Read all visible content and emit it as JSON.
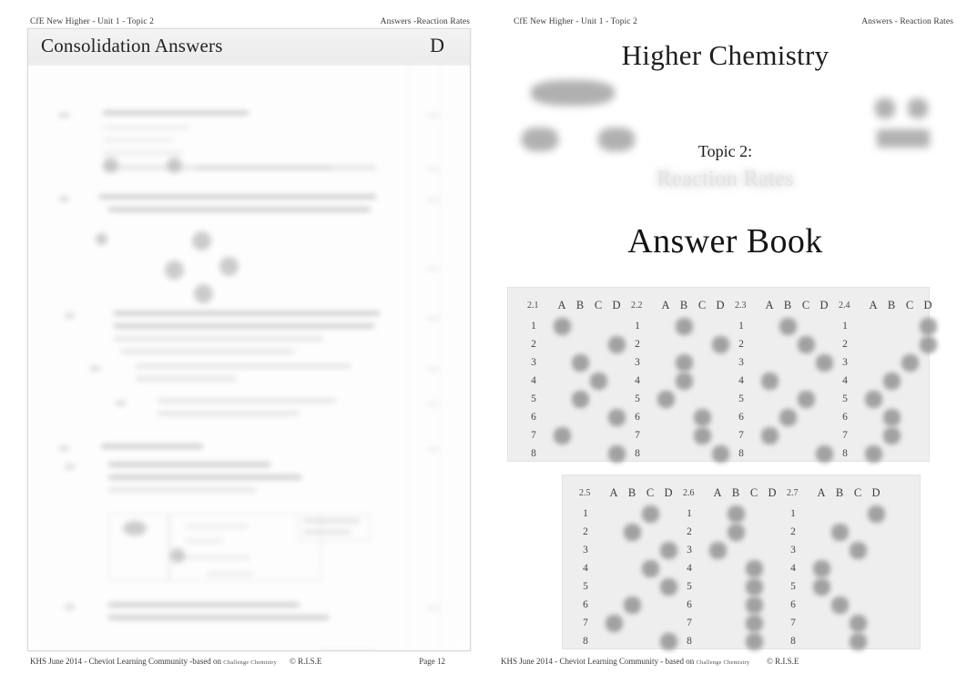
{
  "document": {
    "subject": "Higher Chemistry",
    "topic_label": "Topic 2:",
    "topic_name": "Reaction Rates",
    "book_type": "Answer Book"
  },
  "left_page": {
    "running_head_left": "CfE New Higher - Unit 1 - Topic 2",
    "running_head_right": "Answers -Reaction Rates",
    "sheet_title": "Consolidation Answers",
    "sheet_letter": "D",
    "body_note": "Worked answer text (blurred / illegible in source)",
    "footer": {
      "credit": "KHS June 2014 - Cheviot Learning Community -based on",
      "credit_brand": "Challenge Chemistry",
      "rights": "© R.I.S.E",
      "page": "Page 12"
    }
  },
  "right_page": {
    "running_head_left": "CfE New Higher - Unit 1 - Topic 2",
    "running_head_right": "Answers - Reaction Rates",
    "footer": {
      "credit": "KHS June 2014 - Cheviot Learning Community - based on",
      "credit_brand": "Challenge Chemistry",
      "rights": "© R.I.S.E"
    }
  },
  "answer_grids": {
    "columns": [
      "A",
      "B",
      "C",
      "D"
    ],
    "rows": [
      "1",
      "2",
      "3",
      "4",
      "5",
      "6",
      "7",
      "8"
    ],
    "top_row": [
      {
        "id": "2.1",
        "answers": [
          "A",
          "D",
          "B",
          "C",
          "B",
          "D",
          "A",
          "D"
        ]
      },
      {
        "id": "2.2",
        "answers": [
          "B",
          "D",
          "B",
          "B",
          "A",
          "C",
          "C",
          "D"
        ]
      },
      {
        "id": "2.3",
        "answers": [
          "B",
          "C",
          "D",
          "A",
          "C",
          "B",
          "A",
          "D"
        ]
      },
      {
        "id": "2.4",
        "answers": [
          "D",
          "D",
          "C",
          "B",
          "A",
          "B",
          "B",
          "A"
        ]
      }
    ],
    "bottom_row": [
      {
        "id": "2.5",
        "answers": [
          "C",
          "B",
          "D",
          "C",
          "D",
          "B",
          "A",
          "D"
        ]
      },
      {
        "id": "2.6",
        "answers": [
          "B",
          "B",
          "A",
          "C",
          "C",
          "C",
          "C",
          "C"
        ]
      },
      {
        "id": "2.7",
        "answers": [
          "D",
          "B",
          "C",
          "A",
          "A",
          "B",
          "C",
          "C"
        ]
      }
    ]
  },
  "colors": {
    "panel_background": "#eeeeee",
    "mark": "#8e8e8e",
    "text": "#2b2b2b",
    "ghost_title": "#e4e4e4"
  }
}
